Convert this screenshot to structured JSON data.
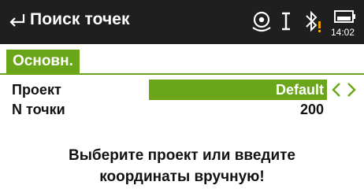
{
  "titlebar": {
    "title": "Поиск точек",
    "time": "14:02",
    "icons": {
      "back": "back-arrow-icon",
      "gps": "gps-status-icon",
      "cursor": "text-cursor-icon",
      "bluetooth": "bluetooth-warning-icon",
      "battery": "battery-icon"
    }
  },
  "tab": {
    "label": "Основн."
  },
  "form": {
    "project_label": "Проект",
    "project_value": "Default",
    "point_label": "N точки",
    "point_value": "200"
  },
  "message": {
    "line1": "Выберите проект или введите",
    "line2": "координаты вручную!"
  },
  "colors": {
    "accent": "#6aa51a",
    "titlebar_bg": "#1f1f1f",
    "warning": "#e8a000"
  }
}
